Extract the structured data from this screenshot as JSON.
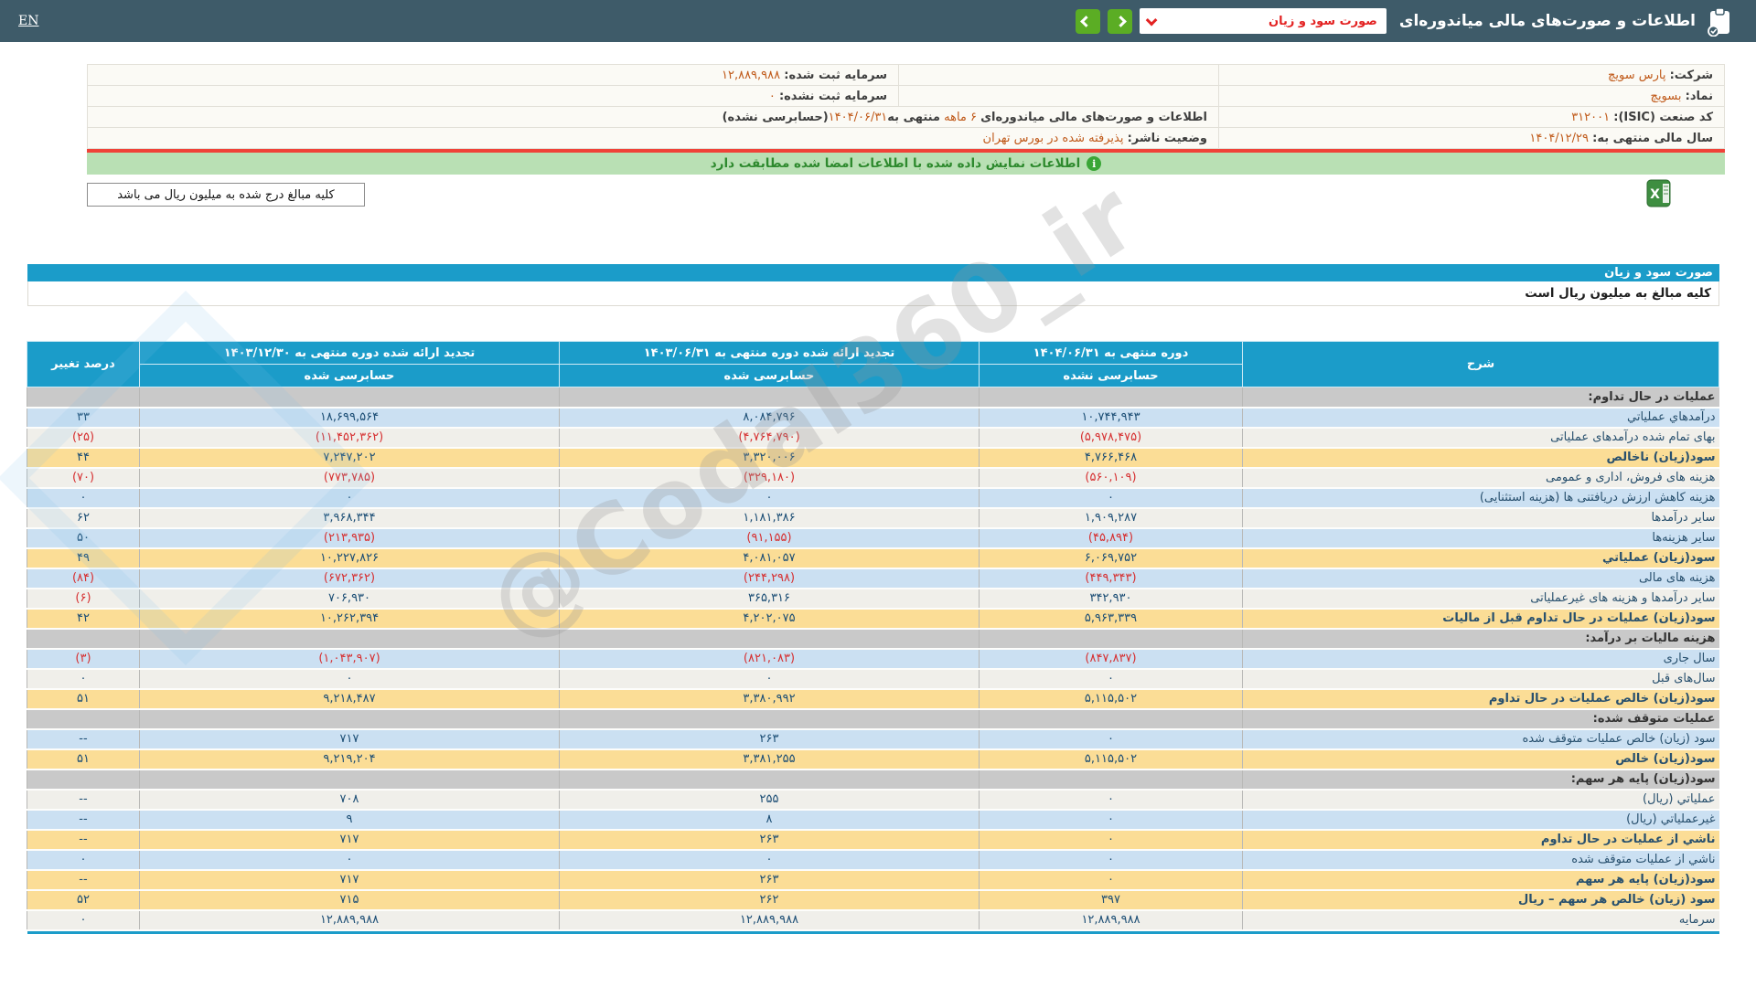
{
  "topbar": {
    "en": "EN",
    "title": "اطلاعات و صورت‌های مالی میاندوره‌ای",
    "dropdown_value": "صورت سود و زیان"
  },
  "icons": {
    "topbar_icon": "clipboard-check-icon",
    "dropdown_caret": "chevron-down-icon",
    "nav_buttons": [
      "chevron-right-icon",
      "chevron-left-icon"
    ],
    "banner_icon": "info-circle-icon",
    "export_icon": "excel-file-icon"
  },
  "info": {
    "company_label": "شرکت:",
    "company": "پارس سویچ",
    "symbol_label": "نماد:",
    "symbol": "بسویچ",
    "isic_label": "کد صنعت (ISIC):",
    "isic": "۳۱۲۰۰۱",
    "fiscal_label": "سال مالی منتهی به:",
    "fiscal": "۱۴۰۴/۱۲/۲۹",
    "reg_cap_label": "سرمایه ثبت شده:",
    "reg_cap": "۱۲,۸۸۹,۹۸۸",
    "unreg_cap_label": "سرمایه ثبت نشده:",
    "unreg_cap": "۰",
    "period_prefix": "اطلاعات و صورت‌های مالی میاندوره‌ای",
    "period_len": "۶ ماهه",
    "period_mid": "منتهی به",
    "period_date": "۱۴۰۴/۰۶/۳۱",
    "period_suffix": "(حسابرسی نشده)",
    "status_label": "وضعیت ناشر:",
    "status": "پذیرفته شده در بورس تهران"
  },
  "banner": {
    "text": "اطلاعات نمایش داده شده با اطلاعات امضا شده مطابقت دارد",
    "icon_glyph": "i"
  },
  "notes": {
    "million_rial_box": "کلیه مبالغ درج شده به میلیون ریال می باشد"
  },
  "statement": {
    "title": "صورت سود و زیان",
    "note": "کلیه مبالغ به میلیون ریال است"
  },
  "watermark": "@Codal360_ir",
  "colors": {
    "topbar_bg": "#3E5B69",
    "accent_blue": "#1B9CC9",
    "button_green": "#5BAD24",
    "dropdown_red": "#E32222",
    "divider_red": "#F04238",
    "value_orange": "#C05A1A",
    "banner_green_bg": "#B9E0B4",
    "banner_green_text": "#2E8A2E",
    "row_blue": "#CBE0F2",
    "row_gray": "#F0EFEA",
    "row_yellow": "#FBDD96",
    "row_section_gray": "#C9C9C9",
    "number_navy": "#1C4E75",
    "number_negative_red": "#D63031"
  },
  "table": {
    "headers": {
      "desc": "شرح",
      "col1_top": "دوره منتهی به ۱۴۰۴/۰۶/۳۱",
      "col1_sub": "حسابرسی نشده",
      "col2_top": "تجدید ارائه شده دوره منتهی به ۱۴۰۳/۰۶/۳۱",
      "col2_sub": "حسابرسی شده",
      "col3_top": "تجدید ارائه شده دوره منتهی به ۱۴۰۳/۱۲/۳۰",
      "col3_sub": "حسابرسی شده",
      "pct": "درصد تغییر"
    },
    "rows": [
      {
        "type": "section",
        "style": "section",
        "label": "عملیات در حال تداوم:"
      },
      {
        "type": "data",
        "style": "blue",
        "label": "درآمدهاي عملیاتي",
        "v1": "۱۰,۷۴۴,۹۴۳",
        "v2": "۸,۰۸۴,۷۹۶",
        "v3": "۱۸,۶۹۹,۵۶۴",
        "pct": "۳۳"
      },
      {
        "type": "data",
        "style": "gray",
        "label": "بهای تمام شده درآمدهای عملیاتی",
        "v1": "(۵,۹۷۸,۴۷۵)",
        "v2": "(۴,۷۶۴,۷۹۰)",
        "v3": "(۱۱,۴۵۲,۳۶۲)",
        "pct": "(۲۵)"
      },
      {
        "type": "data",
        "style": "yellow",
        "label": "سود(زیان) ناخالص",
        "v1": "۴,۷۶۶,۴۶۸",
        "v2": "۳,۳۲۰,۰۰۶",
        "v3": "۷,۲۴۷,۲۰۲",
        "pct": "۴۴"
      },
      {
        "type": "data",
        "style": "gray",
        "label": "هزینه های فروش، اداری و عمومی",
        "v1": "(۵۶۰,۱۰۹)",
        "v2": "(۳۲۹,۱۸۰)",
        "v3": "(۷۷۳,۷۸۵)",
        "pct": "(۷۰)"
      },
      {
        "type": "data",
        "style": "blue",
        "label": "هزینه کاهش ارزش دریافتنی ها (هزینه استثنایی)",
        "v1": "۰",
        "v2": "۰",
        "v3": "۰",
        "pct": "۰"
      },
      {
        "type": "data",
        "style": "gray",
        "label": "سایر درآمدها",
        "v1": "۱,۹۰۹,۲۸۷",
        "v2": "۱,۱۸۱,۳۸۶",
        "v3": "۳,۹۶۸,۳۴۴",
        "pct": "۶۲"
      },
      {
        "type": "data",
        "style": "blue",
        "label": "سایر هزینه‌ها",
        "v1": "(۴۵,۸۹۴)",
        "v2": "(۹۱,۱۵۵)",
        "v3": "(۲۱۳,۹۳۵)",
        "pct": "۵۰"
      },
      {
        "type": "data",
        "style": "yellow",
        "label": "سود(زیان) عملیاتي",
        "v1": "۶,۰۶۹,۷۵۲",
        "v2": "۴,۰۸۱,۰۵۷",
        "v3": "۱۰,۲۲۷,۸۲۶",
        "pct": "۴۹"
      },
      {
        "type": "data",
        "style": "blue",
        "label": "هزینه های مالی",
        "v1": "(۴۴۹,۳۴۳)",
        "v2": "(۲۴۴,۲۹۸)",
        "v3": "(۶۷۲,۳۶۲)",
        "pct": "(۸۴)"
      },
      {
        "type": "data",
        "style": "gray",
        "label": "سایر درآمدها و هزینه های غیرعملیاتی",
        "v1": "۳۴۲,۹۳۰",
        "v2": "۳۶۵,۳۱۶",
        "v3": "۷۰۶,۹۳۰",
        "pct": "(۶)"
      },
      {
        "type": "data",
        "style": "yellow",
        "label": "سود(زیان) عملیات در حال تداوم قبل از مالیات",
        "v1": "۵,۹۶۳,۳۳۹",
        "v2": "۴,۲۰۲,۰۷۵",
        "v3": "۱۰,۲۶۲,۳۹۴",
        "pct": "۴۲"
      },
      {
        "type": "section",
        "style": "section",
        "label": "هزینه مالیات بر درآمد:"
      },
      {
        "type": "data",
        "style": "blue",
        "label": "سال جاری",
        "v1": "(۸۴۷,۸۳۷)",
        "v2": "(۸۲۱,۰۸۳)",
        "v3": "(۱,۰۴۳,۹۰۷)",
        "pct": "(۳)"
      },
      {
        "type": "data",
        "style": "gray",
        "label": "سال‌های قبل",
        "v1": "۰",
        "v2": "۰",
        "v3": "۰",
        "pct": "۰"
      },
      {
        "type": "data",
        "style": "yellow",
        "label": "سود(زیان) خالص عملیات در حال تداوم",
        "v1": "۵,۱۱۵,۵۰۲",
        "v2": "۳,۳۸۰,۹۹۲",
        "v3": "۹,۲۱۸,۴۸۷",
        "pct": "۵۱"
      },
      {
        "type": "section",
        "style": "section",
        "label": "عملیات متوقف شده:"
      },
      {
        "type": "data",
        "style": "blue",
        "label": "سود (زیان) خالص عملیات متوقف شده",
        "v1": "۰",
        "v2": "۲۶۳",
        "v3": "۷۱۷",
        "pct": "--"
      },
      {
        "type": "data",
        "style": "yellow",
        "label": "سود(زیان) خالص",
        "v1": "۵,۱۱۵,۵۰۲",
        "v2": "۳,۳۸۱,۲۵۵",
        "v3": "۹,۲۱۹,۲۰۴",
        "pct": "۵۱"
      },
      {
        "type": "section",
        "style": "section",
        "label": "سود(زیان) پایه هر سهم:"
      },
      {
        "type": "data",
        "style": "gray",
        "label": "عملیاتي (ریال)",
        "v1": "۰",
        "v2": "۲۵۵",
        "v3": "۷۰۸",
        "pct": "--"
      },
      {
        "type": "data",
        "style": "blue",
        "label": "غیرعملیاتي (ریال)",
        "v1": "۰",
        "v2": "۸",
        "v3": "۹",
        "pct": "--"
      },
      {
        "type": "data",
        "style": "yellow",
        "label": "ناشي از عملیات در حال تداوم",
        "v1": "۰",
        "v2": "۲۶۳",
        "v3": "۷۱۷",
        "pct": "--"
      },
      {
        "type": "data",
        "style": "blue",
        "label": "ناشي از عملیات متوقف شده",
        "v1": "۰",
        "v2": "۰",
        "v3": "۰",
        "pct": "۰"
      },
      {
        "type": "data",
        "style": "yellow",
        "label": "سود(زیان) پایه هر سهم",
        "v1": "۰",
        "v2": "۲۶۳",
        "v3": "۷۱۷",
        "pct": "--"
      },
      {
        "type": "data",
        "style": "yellow",
        "label": "سود (زیان) خالص هر سهم – ریال",
        "v1": "۳۹۷",
        "v2": "۲۶۲",
        "v3": "۷۱۵",
        "pct": "۵۲"
      },
      {
        "type": "data",
        "style": "gray",
        "label": "سرمایه",
        "v1": "۱۲,۸۸۹,۹۸۸",
        "v2": "۱۲,۸۸۹,۹۸۸",
        "v3": "۱۲,۸۸۹,۹۸۸",
        "pct": "۰"
      }
    ]
  }
}
